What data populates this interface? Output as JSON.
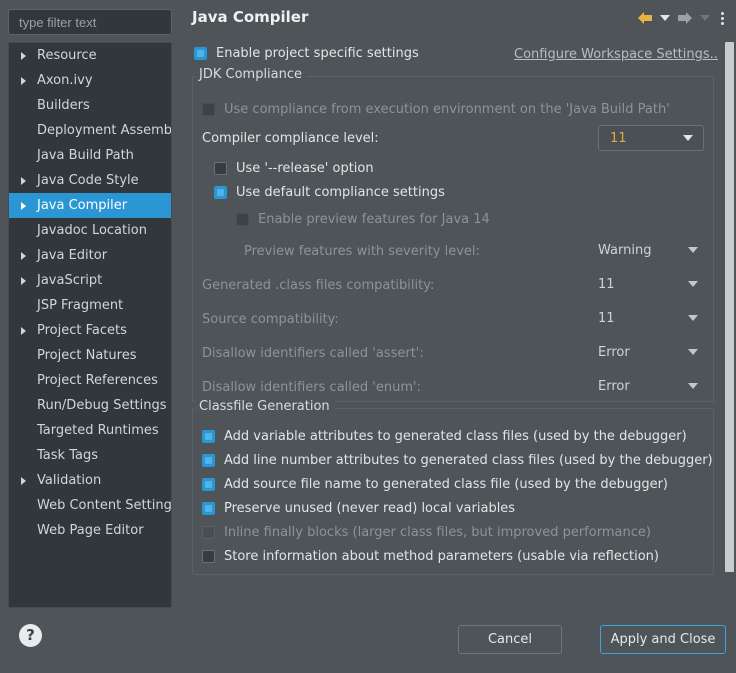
{
  "sidebar": {
    "filter_placeholder": "type filter text",
    "items": [
      {
        "label": "Resource",
        "expandable": true,
        "selected": false
      },
      {
        "label": "Axon.ivy",
        "expandable": true,
        "selected": false
      },
      {
        "label": "Builders",
        "expandable": false,
        "selected": false
      },
      {
        "label": "Deployment Assembly",
        "expandable": false,
        "selected": false
      },
      {
        "label": "Java Build Path",
        "expandable": false,
        "selected": false
      },
      {
        "label": "Java Code Style",
        "expandable": true,
        "selected": false
      },
      {
        "label": "Java Compiler",
        "expandable": true,
        "selected": true
      },
      {
        "label": "Javadoc Location",
        "expandable": false,
        "selected": false
      },
      {
        "label": "Java Editor",
        "expandable": true,
        "selected": false
      },
      {
        "label": "JavaScript",
        "expandable": true,
        "selected": false
      },
      {
        "label": "JSP Fragment",
        "expandable": false,
        "selected": false
      },
      {
        "label": "Project Facets",
        "expandable": true,
        "selected": false
      },
      {
        "label": "Project Natures",
        "expandable": false,
        "selected": false
      },
      {
        "label": "Project References",
        "expandable": false,
        "selected": false
      },
      {
        "label": "Run/Debug Settings",
        "expandable": false,
        "selected": false
      },
      {
        "label": "Targeted Runtimes",
        "expandable": false,
        "selected": false
      },
      {
        "label": "Task Tags",
        "expandable": false,
        "selected": false
      },
      {
        "label": "Validation",
        "expandable": true,
        "selected": false
      },
      {
        "label": "Web Content Settings",
        "expandable": false,
        "selected": false
      },
      {
        "label": "Web Page Editor",
        "expandable": false,
        "selected": false
      }
    ]
  },
  "header": {
    "title": "Java Compiler",
    "back_icon": "back-arrow-icon",
    "forward_icon": "forward-arrow-icon",
    "menu_icon": "vertical-ellipsis-icon"
  },
  "enable_project": {
    "label": "Enable project specific settings",
    "checked": true
  },
  "workspace_link": {
    "label": "Configure Workspace Settings..."
  },
  "jdk_compliance": {
    "title": "JDK Compliance",
    "use_execution_env": {
      "label": "Use compliance from execution environment on the 'Java Build Path'",
      "checked": false,
      "enabled": false
    },
    "compliance_level": {
      "label": "Compiler compliance level:",
      "value": "11"
    },
    "use_release": {
      "label": "Use '--release' option",
      "checked": false,
      "enabled": true
    },
    "use_default_compliance": {
      "label": "Use default compliance settings",
      "checked": true,
      "enabled": true
    },
    "enable_preview": {
      "label": "Enable preview features for Java 14",
      "checked": false,
      "enabled": false
    },
    "preview_severity": {
      "label": "Preview features with severity level:",
      "value": "Warning"
    },
    "generated_class_compat": {
      "label": "Generated .class files compatibility:",
      "value": "11"
    },
    "source_compat": {
      "label": "Source compatibility:",
      "value": "11"
    },
    "disallow_assert": {
      "label": "Disallow identifiers called 'assert':",
      "value": "Error"
    },
    "disallow_enum": {
      "label": "Disallow identifiers called 'enum':",
      "value": "Error"
    }
  },
  "classfile_generation": {
    "title": "Classfile Generation",
    "options": [
      {
        "label": "Add variable attributes to generated class files (used by the debugger)",
        "checked": true,
        "enabled": true
      },
      {
        "label": "Add line number attributes to generated class files (used by the debugger)",
        "checked": true,
        "enabled": true
      },
      {
        "label": "Add source file name to generated class file (used by the debugger)",
        "checked": true,
        "enabled": true
      },
      {
        "label": "Preserve unused (never read) local variables",
        "checked": true,
        "enabled": true
      },
      {
        "label": "Inline finally blocks (larger class files, but improved performance)",
        "checked": false,
        "enabled": false
      },
      {
        "label": "Store information about method parameters (usable via reflection)",
        "checked": false,
        "enabled": true
      }
    ]
  },
  "footer": {
    "help_icon": "help-question-icon",
    "cancel_label": "Cancel",
    "apply_label": "Apply and Close"
  },
  "colors": {
    "background": "#4e5457",
    "tree_background": "#31373a",
    "selection": "#2a97d4",
    "accent_checkbox": "#2a97d4",
    "value_orange": "#e7a84a",
    "back_arrow": "#e8b33e",
    "forward_arrow": "#9aa0a4",
    "primary_border": "#3da3de"
  }
}
